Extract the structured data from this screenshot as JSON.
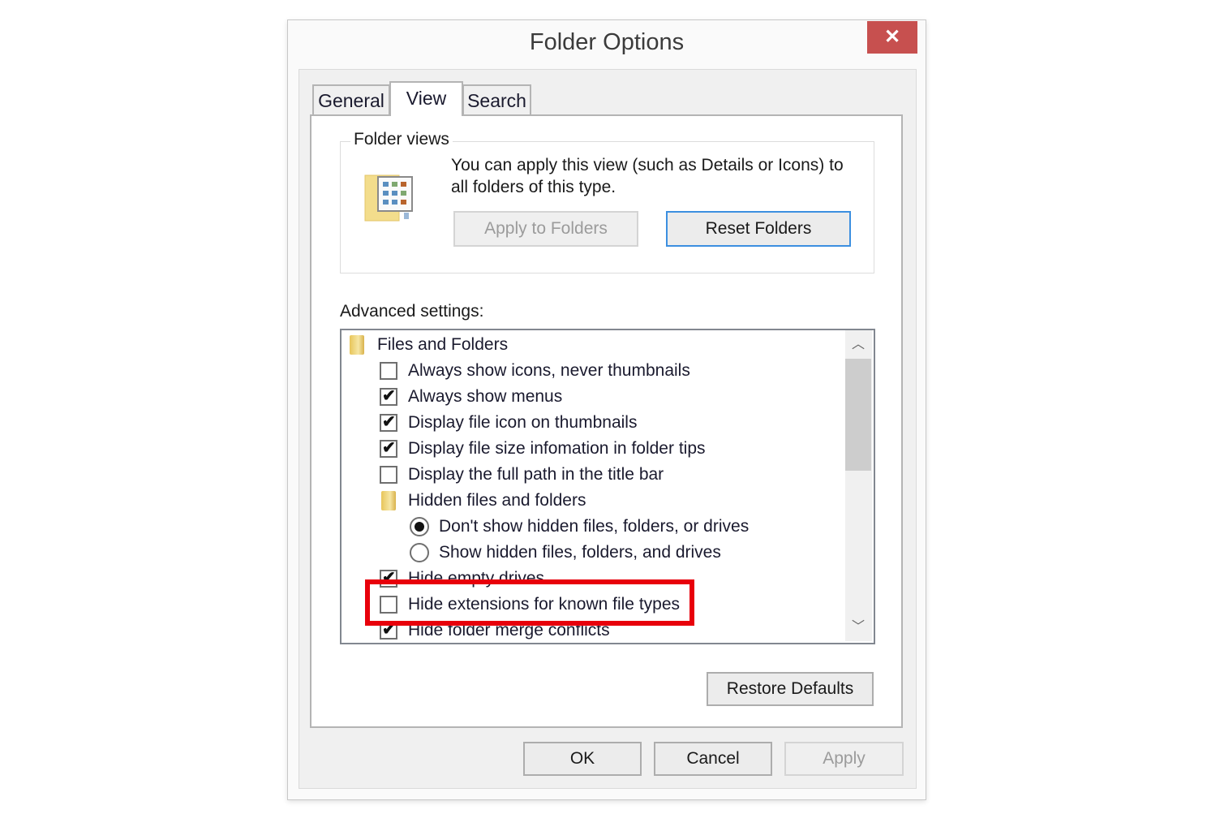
{
  "window": {
    "title": "Folder Options",
    "close_icon": "close-icon"
  },
  "tabs": [
    {
      "label": "General",
      "active": false
    },
    {
      "label": "View",
      "active": true
    },
    {
      "label": "Search",
      "active": false
    }
  ],
  "folder_views": {
    "group_label": "Folder views",
    "icon": "folder-view-icon",
    "description": "You can apply this view (such as Details or Icons) to all folders of this type.",
    "apply_to_folders_label": "Apply to Folders",
    "apply_to_folders_enabled": false,
    "reset_folders_label": "Reset Folders"
  },
  "advanced": {
    "label": "Advanced settings:",
    "items": [
      {
        "type": "folder",
        "label": "Files and Folders",
        "icon": "folder-icon"
      },
      {
        "type": "checkbox",
        "label": "Always show icons, never thumbnails",
        "checked": false
      },
      {
        "type": "checkbox",
        "label": "Always show menus",
        "checked": true
      },
      {
        "type": "checkbox",
        "label": "Display file icon on thumbnails",
        "checked": true
      },
      {
        "type": "checkbox",
        "label": "Display file size infomation in folder tips",
        "checked": true
      },
      {
        "type": "checkbox",
        "label": "Display the full path in the title bar",
        "checked": false
      },
      {
        "type": "folder",
        "label": "Hidden files and folders",
        "icon": "folder-icon"
      },
      {
        "type": "radio",
        "label": "Don't show hidden files, folders, or drives",
        "selected": true
      },
      {
        "type": "radio",
        "label": "Show hidden files, folders, and drives",
        "selected": false
      },
      {
        "type": "checkbox",
        "label": "Hide empty drives",
        "checked": true
      },
      {
        "type": "checkbox",
        "label": "Hide extensions for known file types",
        "checked": false,
        "highlighted": true
      },
      {
        "type": "checkbox",
        "label": "Hide folder merge conflicts",
        "checked": true
      }
    ],
    "scrollbar": {
      "up_icon": "chevron-up-icon",
      "down_icon": "chevron-down-icon",
      "thumb_position_fraction": 0.0
    },
    "restore_defaults_label": "Restore Defaults"
  },
  "footer": {
    "ok_label": "OK",
    "cancel_label": "Cancel",
    "apply_label": "Apply",
    "apply_enabled": false
  },
  "colors": {
    "highlight": "#e8000b",
    "close_button": "#c7504f",
    "focus_border": "#3c8fe0"
  }
}
